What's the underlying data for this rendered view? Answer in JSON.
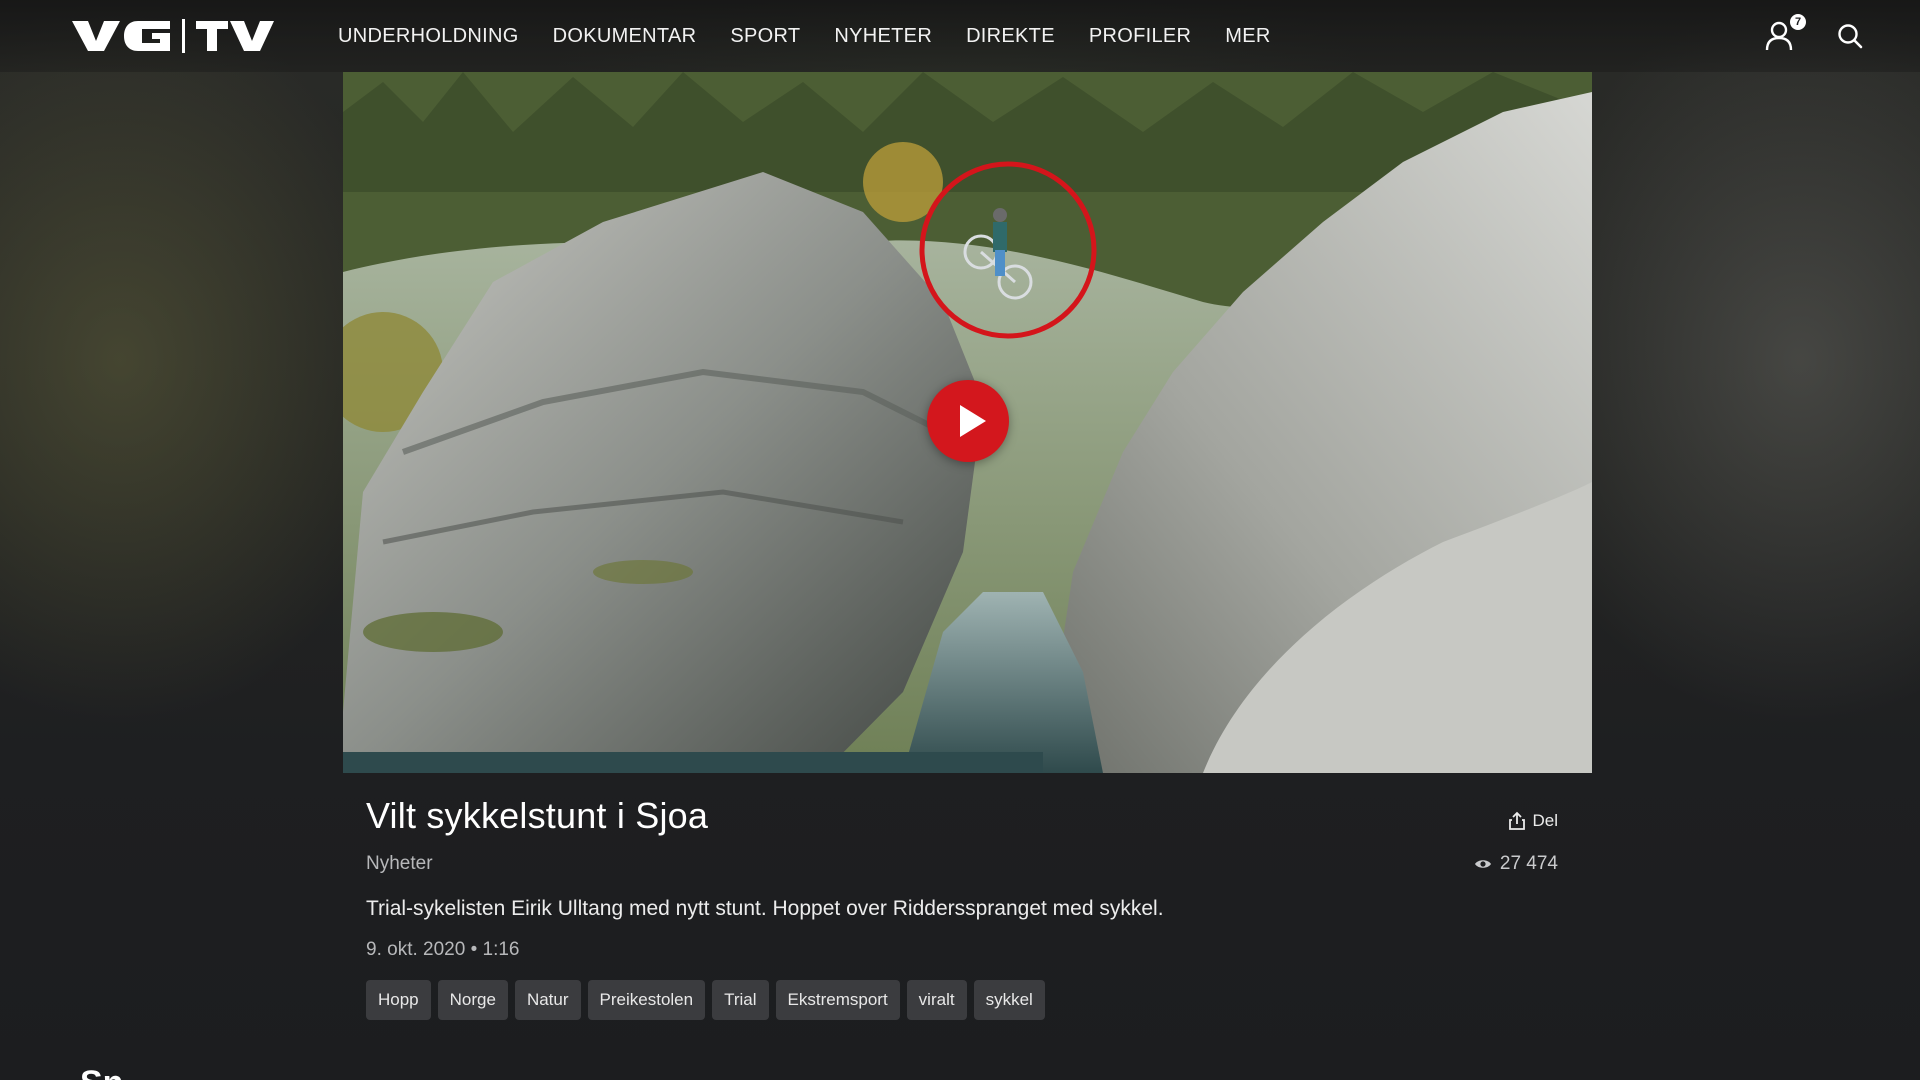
{
  "header": {
    "logo_text": "VG|TV",
    "nav": [
      "UNDERHOLDNING",
      "DOKUMENTAR",
      "SPORT",
      "NYHETER",
      "DIREKTE",
      "PROFILER",
      "MER"
    ],
    "notification_count": "7"
  },
  "video": {
    "title": "Vilt sykkelstunt i Sjoa",
    "category": "Nyheter",
    "description": "Trial-sykelisten Eirik Ulltang med nytt stunt. Hoppet over Riddersspranget med sykkel.",
    "meta": "9. okt. 2020 • 1:16",
    "share_label": "Del",
    "views": "27 474",
    "tags": [
      "Hopp",
      "Norge",
      "Natur",
      "Preikestolen",
      "Trial",
      "Ekstremsport",
      "viralt",
      "sykkel"
    ]
  },
  "colors": {
    "background": "#1c1d1f",
    "play_button": "#d3171d",
    "tag_bg": "#3b3c3f",
    "muted_text": "#b7b8ba"
  },
  "icons": [
    "user-icon",
    "search-icon",
    "play-icon",
    "share-icon",
    "eye-icon"
  ],
  "next_section_heading_partial": "Sn"
}
